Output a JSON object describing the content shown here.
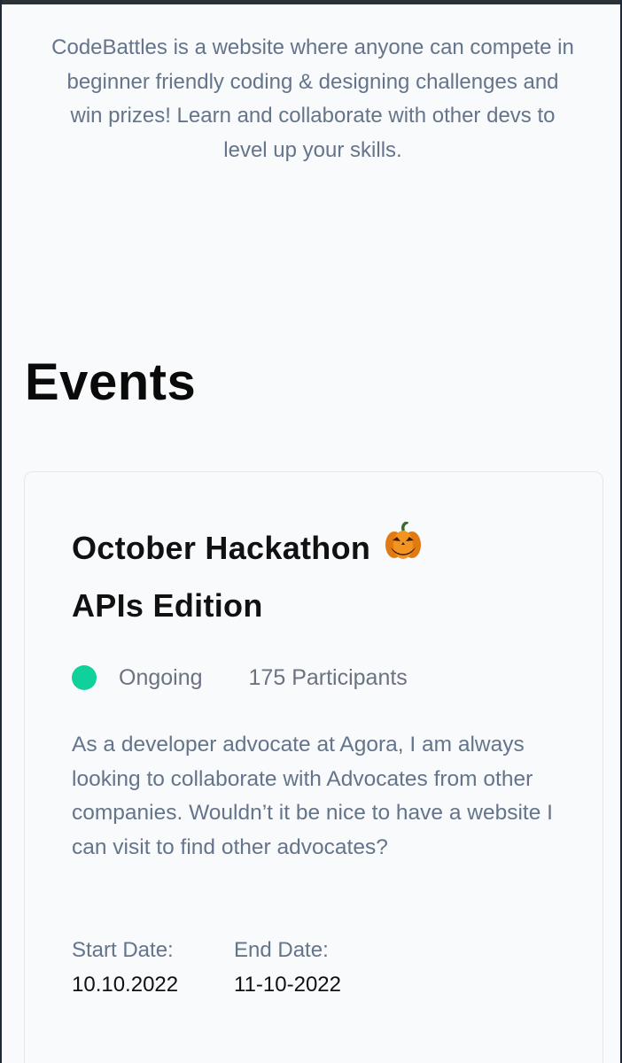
{
  "intro": {
    "text": "CodeBattles is a website where anyone can compete in beginner friendly coding & designing challenges and win prizes! Learn and collaborate with other devs to level up your skills."
  },
  "events": {
    "heading": "Events",
    "items": [
      {
        "title_line1": "October Hackathon",
        "title_icon": "pumpkin-icon",
        "title_line2": "APIs Edition",
        "status": "Ongoing",
        "status_color": "#10d09b",
        "participants": "175 Participants",
        "description": "As a developer advocate at Agora, I am always looking to collaborate with Advocates from other companies. Wouldn’t it be nice to have a website I can visit to find other advocates?",
        "start_label": "Start Date:",
        "start_value": "10.10.2022",
        "end_label": "End Date:",
        "end_value": "11-10-2022"
      }
    ]
  }
}
